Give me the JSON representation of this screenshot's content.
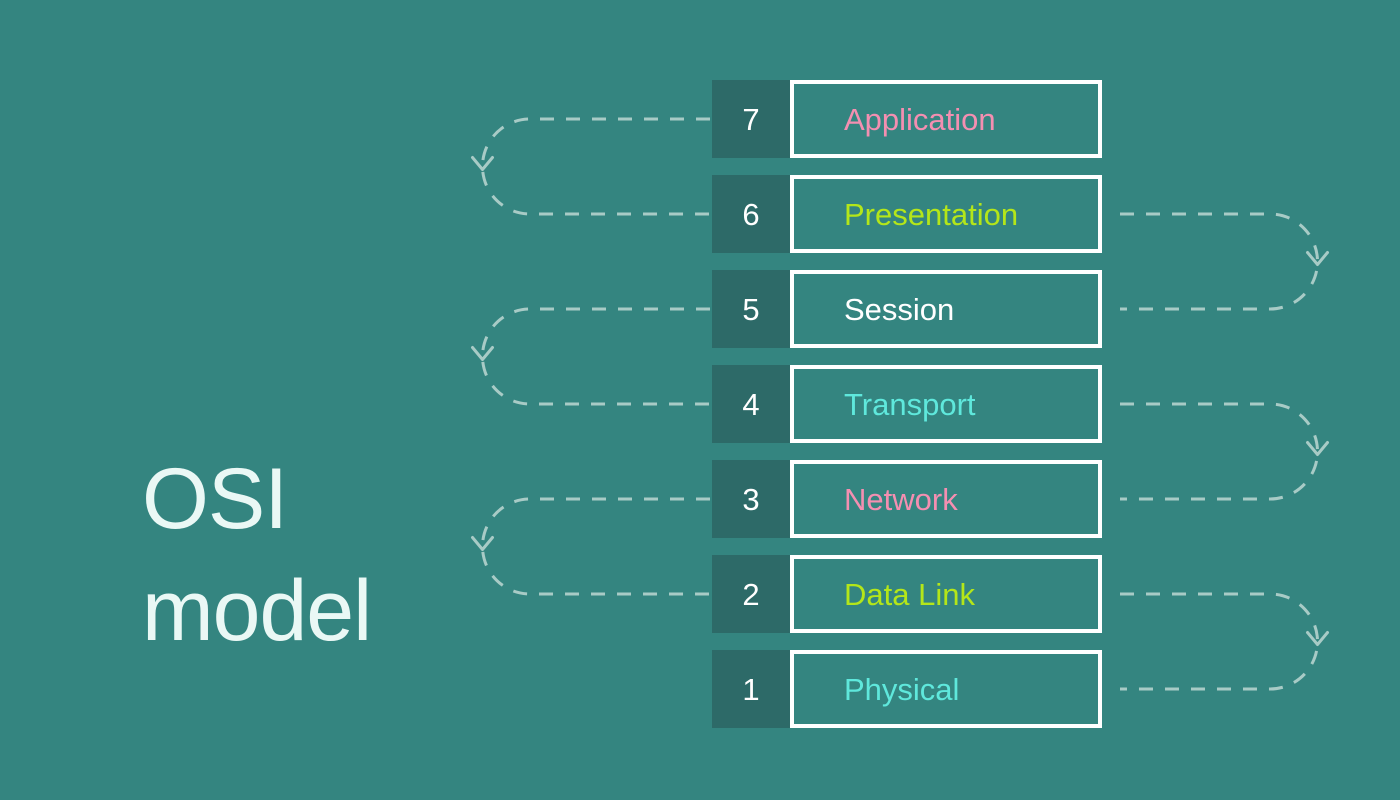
{
  "title": {
    "text": "OSI\nmodel",
    "color": "#EAF8F5"
  },
  "palette": {
    "background": "#348580",
    "number_box": "#2D6A68",
    "box_border": "#FFFFFF",
    "connector": "#A8CBC6"
  },
  "diagram": {
    "name": "OSI model layer stack",
    "layers": [
      {
        "number": "7",
        "label": "Application",
        "color": "#F48FB1"
      },
      {
        "number": "6",
        "label": "Presentation",
        "color": "#B4E619"
      },
      {
        "number": "5",
        "label": "Session",
        "color": "#FFFFFF"
      },
      {
        "number": "4",
        "label": "Transport",
        "color": "#5FE8DC"
      },
      {
        "number": "3",
        "label": "Network",
        "color": "#F48FB1"
      },
      {
        "number": "2",
        "label": "Data Link",
        "color": "#B4E619"
      },
      {
        "number": "1",
        "label": "Physical",
        "color": "#5FE8DC"
      }
    ],
    "connectors": [
      {
        "side": "left",
        "from": "7",
        "to": "6",
        "direction": "down"
      },
      {
        "side": "right",
        "from": "6",
        "to": "5",
        "direction": "down"
      },
      {
        "side": "left",
        "from": "5",
        "to": "4",
        "direction": "down"
      },
      {
        "side": "right",
        "from": "4",
        "to": "3",
        "direction": "down"
      },
      {
        "side": "left",
        "from": "3",
        "to": "2",
        "direction": "down"
      },
      {
        "side": "right",
        "from": "2",
        "to": "1",
        "direction": "down"
      }
    ]
  }
}
